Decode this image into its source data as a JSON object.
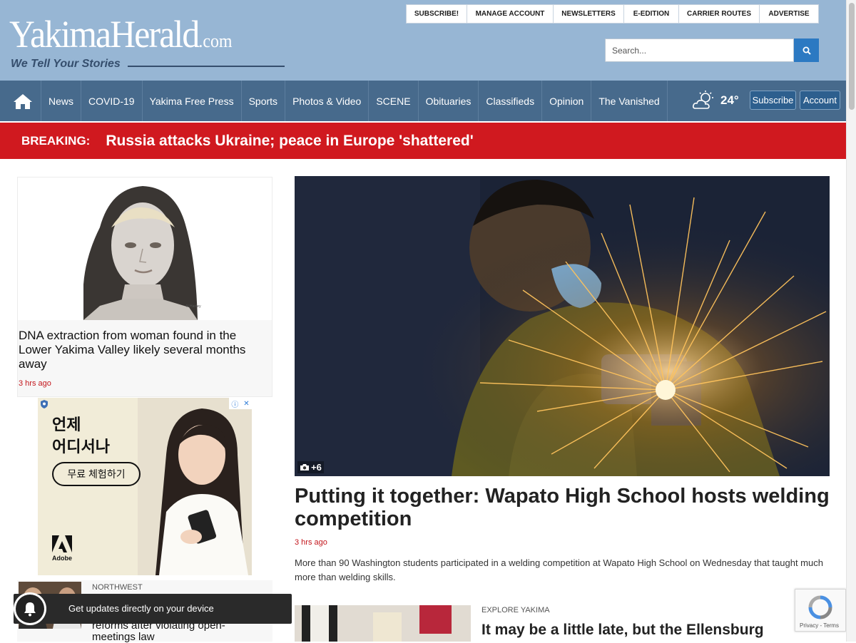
{
  "logo": {
    "main": "YakimaHerald",
    "suffix": ".com",
    "tagline": "We Tell Your Stories"
  },
  "top_links": [
    "SUBSCRIBE!",
    "MANAGE ACCOUNT",
    "NEWSLETTERS",
    "E-EDITION",
    "CARRIER ROUTES",
    "ADVERTISE"
  ],
  "search": {
    "placeholder": "Search..."
  },
  "nav": {
    "items": [
      "News",
      "COVID-19",
      "Yakima Free Press",
      "Sports",
      "Photos & Video",
      "SCENE",
      "Obituaries",
      "Classifieds",
      "Opinion",
      "The Vanished"
    ],
    "weather": {
      "temp": "24°",
      "icon": "partly-cloudy-icon"
    },
    "subscribe": "Subscribe",
    "account": "Account"
  },
  "breaking": {
    "label": "BREAKING:",
    "text": "Russia attacks Ukraine; peace in Europe 'shattered'"
  },
  "left_story": {
    "title": "DNA extraction from woman found in the Lower Yakima Valley likely several months away",
    "time": "3 hrs ago"
  },
  "ad": {
    "line1": "언제",
    "line2": "어디서나",
    "cta": "무료 체험하기",
    "brand": "Adobe"
  },
  "northwest_story": {
    "category": "NORTHWEST",
    "title": "reforms after violating open-meetings law"
  },
  "notification": {
    "text": "Get updates directly on your device"
  },
  "hero": {
    "photo_count": "+6",
    "title": "Putting it together: Wapato High School hosts welding competition",
    "time": "3 hrs ago",
    "description": "More than 90 Washington students participated in a welding competition at Wapato High School on Wednesday that taught much more than welding skills."
  },
  "second_story": {
    "category": "EXPLORE YAKIMA",
    "title": "It may be a little late, but the Ellensburg"
  },
  "recaptcha": {
    "text": "Privacy - Terms"
  },
  "colors": {
    "header_bg": "#97b6d4",
    "nav_bg": "#476a8c",
    "breaking_bg": "#d0191f",
    "time_red": "#c3161c",
    "search_btn": "#2c79c2"
  }
}
